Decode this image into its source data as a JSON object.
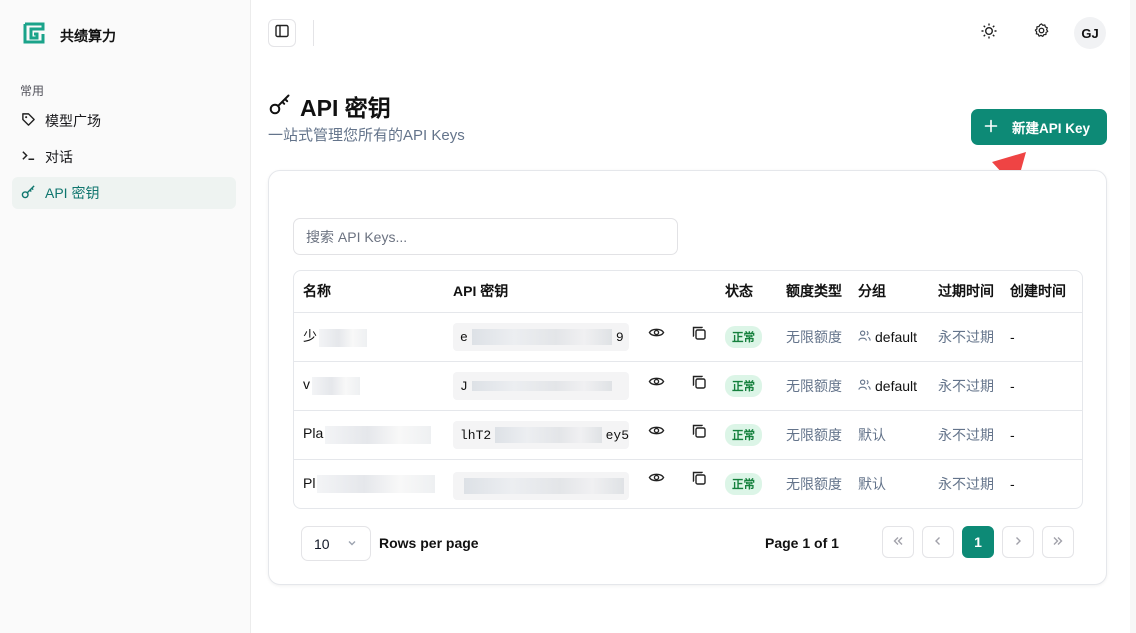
{
  "brand": {
    "name": "共绩算力",
    "accent": "#0d8a76"
  },
  "sidebar": {
    "section": "常用",
    "items": [
      {
        "label": "模型广场",
        "icon": "tag-icon"
      },
      {
        "label": "对话",
        "icon": "terminal-icon"
      },
      {
        "label": "API 密钥",
        "icon": "key-icon",
        "active": true
      }
    ]
  },
  "header": {
    "avatar": "GJ",
    "icons": [
      "sidebar-toggle-icon",
      "sun-icon",
      "gear-icon"
    ]
  },
  "page": {
    "title": "API 密钥",
    "subtitle": "一站式管理您所有的API Keys",
    "new_button": "新建API Key"
  },
  "search": {
    "placeholder": "搜索 API Keys..."
  },
  "table": {
    "columns": [
      "名称",
      "API 密钥",
      "状态",
      "额度类型",
      "分组",
      "过期时间",
      "创建时间"
    ],
    "rows": [
      {
        "name": "少",
        "key_start": "e",
        "key_end": "9",
        "status": "正常",
        "quota": "无限额度",
        "group": "default",
        "group_icon": true,
        "expiry": "永不过期",
        "created": "-"
      },
      {
        "name": "v",
        "key_start": "J",
        "key_end": "",
        "status": "正常",
        "quota": "无限额度",
        "group": "default",
        "group_icon": true,
        "expiry": "永不过期",
        "created": "-"
      },
      {
        "name": "Pla",
        "key_start": "lhT2",
        "key_end": "ey5",
        "status": "正常",
        "quota": "无限额度",
        "group": "默认",
        "group_icon": false,
        "expiry": "永不过期",
        "created": "-"
      },
      {
        "name": "Pl",
        "key_start": "",
        "key_end": "",
        "status": "正常",
        "quota": "无限额度",
        "group": "默认",
        "group_icon": false,
        "expiry": "永不过期",
        "created": "-"
      }
    ]
  },
  "pagination": {
    "rows_per_page_value": "10",
    "rows_per_page_label": "Rows per page",
    "page_info": "Page 1 of 1",
    "current_page": "1"
  }
}
